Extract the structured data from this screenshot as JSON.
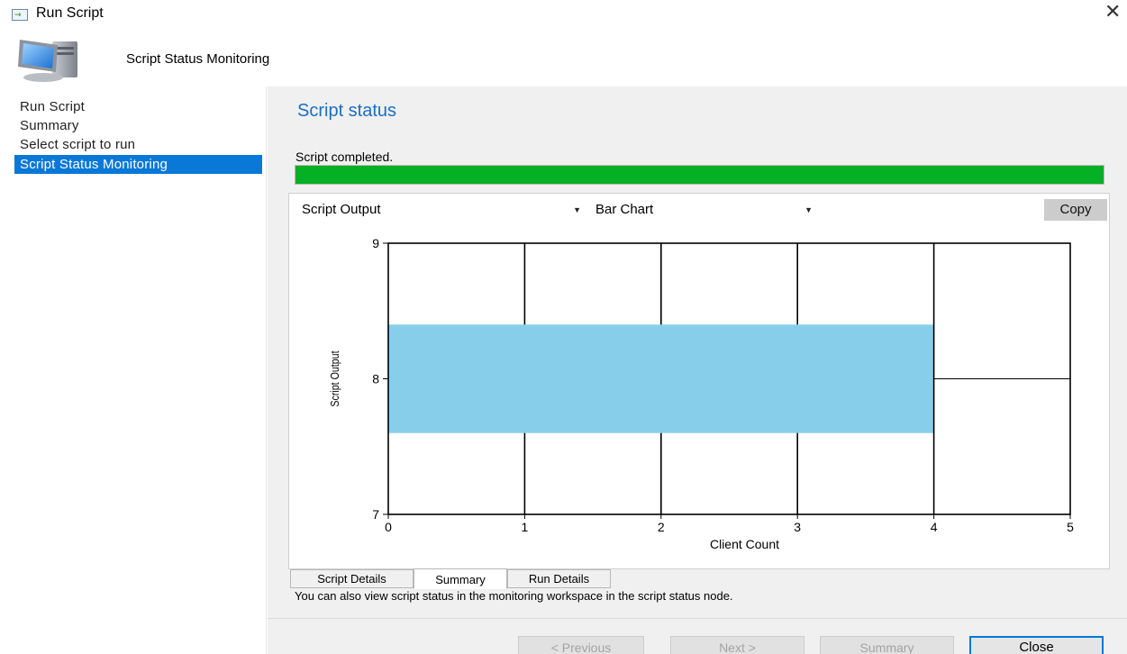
{
  "window": {
    "title": "Run Script",
    "close_glyph": "✕",
    "icon": "run-script-icon"
  },
  "header": {
    "title": "Script Status Monitoring",
    "icon": "computer-icon"
  },
  "sidebar": {
    "items": [
      {
        "label": "Run Script",
        "active": false
      },
      {
        "label": "Summary",
        "active": false
      },
      {
        "label": "Select script to run",
        "active": false
      },
      {
        "label": "Script Status Monitoring",
        "active": true
      }
    ]
  },
  "main": {
    "section_title": "Script status",
    "status_text": "Script completed.",
    "progress": 1.0,
    "output_dropdown": "Script Output",
    "chart_type_dropdown": "Bar Chart",
    "copy_label": "Copy",
    "tabs": [
      {
        "label": "Script Details",
        "selected": false
      },
      {
        "label": "Summary",
        "selected": true
      },
      {
        "label": "Run Details",
        "selected": false
      }
    ],
    "info_text": "You can also view script status in the monitoring workspace in the script status node."
  },
  "buttons": {
    "previous": "< Previous",
    "next": "Next >",
    "summary": "Summary",
    "close": "Close"
  },
  "colors": {
    "accent": "#0a78d7",
    "progress": "#06b025",
    "bar": "#87ceeb",
    "title_blue": "#1a6ec4"
  },
  "chart_data": {
    "type": "bar",
    "orientation": "horizontal",
    "categories": [
      "8"
    ],
    "values": [
      4
    ],
    "xlabel": "Client Count",
    "ylabel": "Script Output",
    "xlim": [
      0,
      5
    ],
    "ylim": [
      7,
      9
    ],
    "xticks": [
      "0",
      "1",
      "2",
      "3",
      "4",
      "5"
    ],
    "yticks": [
      "7",
      "8",
      "9"
    ],
    "grid": true
  }
}
